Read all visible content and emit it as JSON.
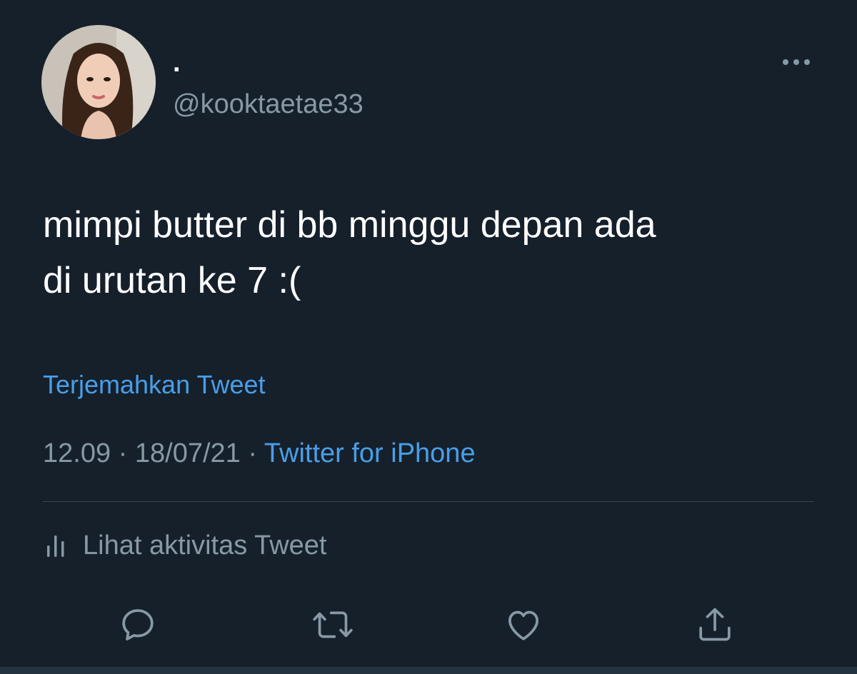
{
  "user": {
    "display_name": ".",
    "handle": "@kooktaetae33"
  },
  "tweet": {
    "text_line_1": "mimpi butter di bb minggu depan ada",
    "text_line_2": "di urutan ke 7 :(",
    "translate_label": "Terjemahkan Tweet",
    "time": "12.09",
    "separator": "·",
    "date": "18/07/21",
    "source": "Twitter for iPhone"
  },
  "activity": {
    "label": "Lihat aktivitas Tweet"
  },
  "actions": {
    "icons": [
      "reply-icon",
      "retweet-icon",
      "like-icon",
      "share-icon"
    ]
  },
  "colors": {
    "background": "#15202b",
    "text_primary": "#ffffff",
    "text_secondary": "#8899a6",
    "accent": "#4a9ee8",
    "divider": "#38444d"
  }
}
